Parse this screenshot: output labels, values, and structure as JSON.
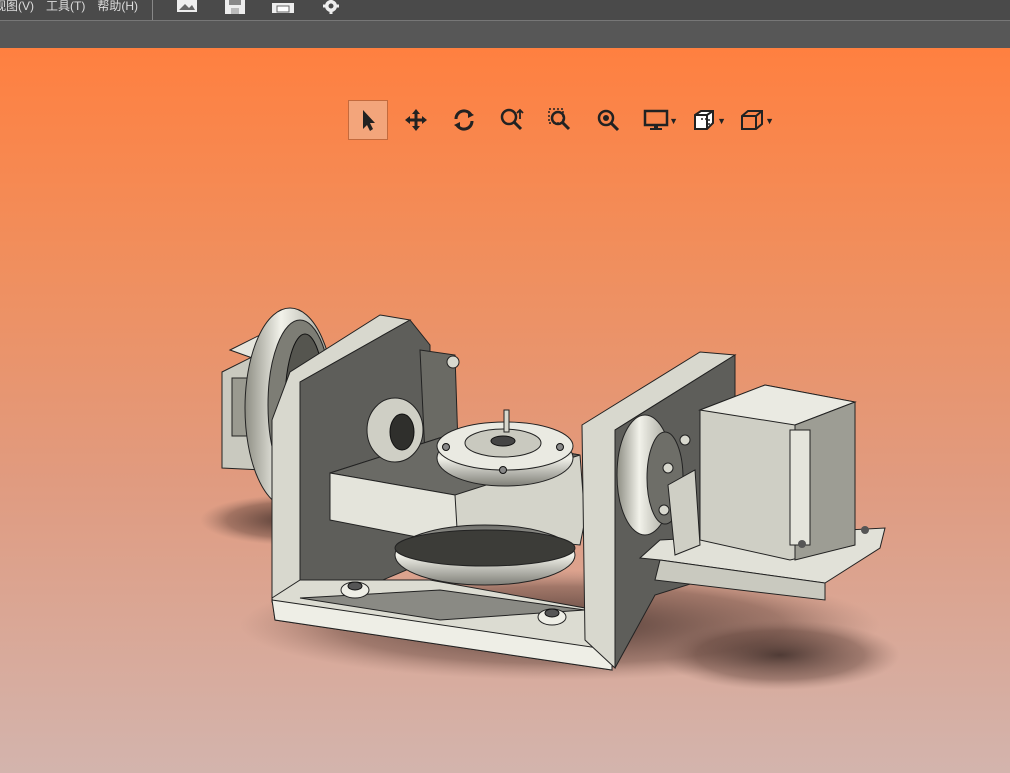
{
  "menubar": {
    "items": [
      {
        "label": "视图(V)"
      },
      {
        "label": "工具(T)"
      },
      {
        "label": "帮助(H)"
      }
    ],
    "quick_icons": [
      "image-icon",
      "save-icon",
      "print-icon",
      "gear-icon"
    ]
  },
  "view_toolbar": {
    "buttons": [
      {
        "icon": "select-arrow-icon",
        "active": true
      },
      {
        "icon": "pan-icon"
      },
      {
        "icon": "rotate-icon"
      },
      {
        "icon": "zoom-icon"
      },
      {
        "icon": "zoom-area-icon"
      },
      {
        "icon": "zoom-fit-icon"
      },
      {
        "icon": "display-icon",
        "dropdown": true
      },
      {
        "icon": "section-view-icon",
        "dropdown": true
      },
      {
        "icon": "view-orientation-icon",
        "dropdown": true
      }
    ]
  },
  "viewport": {
    "background_top": "#ff8040",
    "background_bottom": "#d3b4ad",
    "model": "rotary-tilt-table-assembly"
  }
}
